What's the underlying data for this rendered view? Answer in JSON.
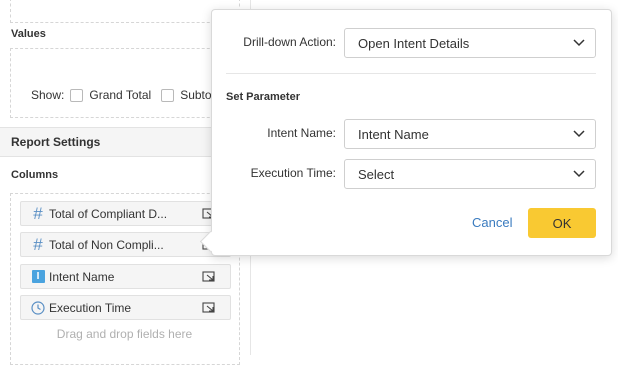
{
  "left": {
    "values_label": "Values",
    "show_label": "Show:",
    "grand_total_label": "Grand Total",
    "subtotal_label": "Subtot",
    "report_settings_title": "Report Settings",
    "columns_label": "Columns",
    "fields": [
      {
        "label": "Total of Compliant D...",
        "icon": "hash-icon"
      },
      {
        "label": "Total of Non Compli...",
        "icon": "hash-icon"
      },
      {
        "label": "Intent Name",
        "icon": "text-field-icon"
      },
      {
        "label": "Execution Time",
        "icon": "clock-icon"
      }
    ],
    "drag_hint": "Drag and drop fields here"
  },
  "popup": {
    "drill_label": "Drill-down Action:",
    "drill_value": "Open Intent Details",
    "section_title": "Set Parameter",
    "intent_label": "Intent Name:",
    "intent_value": "Intent Name",
    "exec_label": "Execution Time:",
    "exec_value": "Select",
    "cancel_label": "Cancel",
    "ok_label": "OK"
  },
  "colors": {
    "accent_blue": "#3a7bbf",
    "ok_yellow": "#f9c932",
    "icon_blue": "#4aa3df"
  }
}
